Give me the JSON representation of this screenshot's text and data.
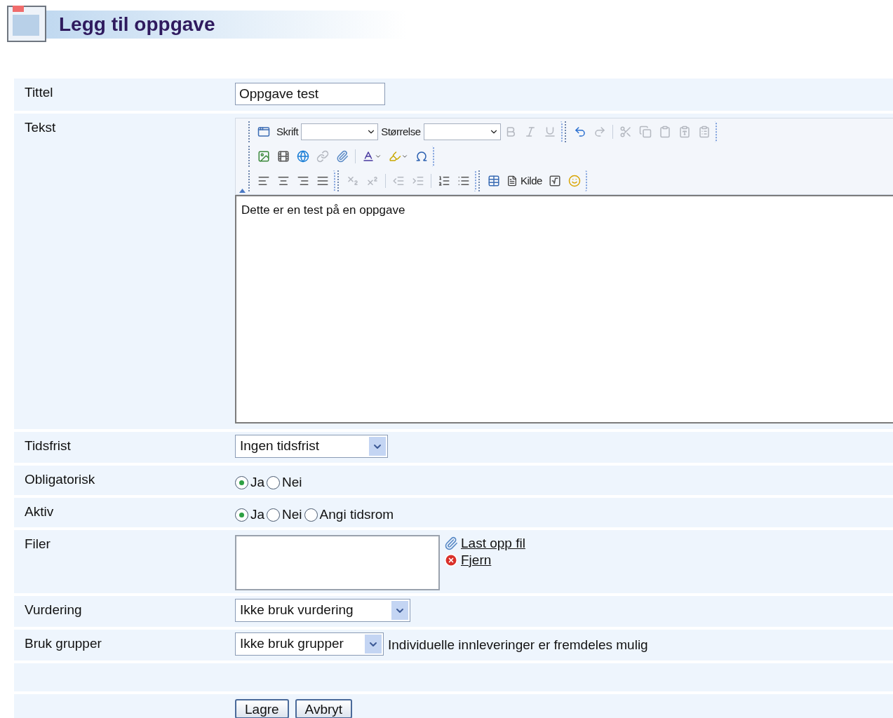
{
  "page_title": "Legg til oppgave",
  "form": [
    {
      "label": "Tittel",
      "kind": "text",
      "value": "Oppgave test"
    },
    {
      "label": "Tekst",
      "kind": "editor",
      "toolbar": [
        {
          "groups": [
            [
              {
                "kind": "maximize",
                "disabled": false
              },
              {
                "kind": "label",
                "text": "Skrift"
              },
              {
                "kind": "dropdown"
              },
              {
                "kind": "label",
                "text": "Størrelse"
              },
              {
                "kind": "dropdown"
              },
              {
                "kind": "bold",
                "disabled": true
              },
              {
                "kind": "italic",
                "disabled": true
              },
              {
                "kind": "underline",
                "disabled": true
              }
            ],
            [
              {
                "kind": "undo",
                "disabled": false
              },
              {
                "kind": "redo",
                "disabled": true
              },
              {
                "kind": "separator"
              },
              {
                "kind": "cut",
                "disabled": true
              },
              {
                "kind": "copy",
                "disabled": true
              },
              {
                "kind": "paste",
                "disabled": true
              },
              {
                "kind": "paste_text",
                "disabled": true
              },
              {
                "kind": "paste_word",
                "disabled": true
              }
            ]
          ]
        },
        {
          "groups": [
            [
              {
                "kind": "image",
                "disabled": false
              },
              {
                "kind": "flash",
                "disabled": false
              },
              {
                "kind": "globe",
                "disabled": false
              },
              {
                "kind": "link",
                "disabled": true
              },
              {
                "kind": "attach",
                "disabled": false
              },
              {
                "kind": "separator"
              },
              {
                "kind": "text_color",
                "disabled": false
              },
              {
                "kind": "highlight",
                "disabled": false
              },
              {
                "kind": "omega",
                "disabled": false
              }
            ]
          ]
        },
        {
          "groups": [
            [
              {
                "kind": "align_left",
                "disabled": false
              },
              {
                "kind": "align_center",
                "disabled": false
              },
              {
                "kind": "align_right",
                "disabled": false
              },
              {
                "kind": "align_justify",
                "disabled": false
              }
            ],
            [
              {
                "kind": "subscript",
                "disabled": true
              },
              {
                "kind": "superscript",
                "disabled": true
              },
              {
                "kind": "separator"
              },
              {
                "kind": "outdent",
                "disabled": true
              },
              {
                "kind": "indent",
                "disabled": true
              },
              {
                "kind": "separator"
              },
              {
                "kind": "ordered_list",
                "disabled": false
              },
              {
                "kind": "bullet_list",
                "disabled": false
              }
            ],
            [
              {
                "kind": "table",
                "disabled": false
              },
              {
                "kind": "source",
                "text": "Kilde"
              },
              {
                "kind": "math",
                "disabled": false
              },
              {
                "kind": "smiley",
                "disabled": false
              }
            ]
          ]
        }
      ],
      "content": "Dette er en test på en oppgave"
    },
    {
      "label": "Tidsfrist",
      "kind": "select",
      "value": "Ingen tidsfrist"
    },
    {
      "label": "Obligatorisk",
      "kind": "radio",
      "options": [
        {
          "label": "Ja",
          "selected": true
        },
        {
          "label": "Nei",
          "selected": false
        }
      ]
    },
    {
      "label": "Aktiv",
      "kind": "radio",
      "options": [
        {
          "label": "Ja",
          "selected": true
        },
        {
          "label": "Nei",
          "selected": false
        },
        {
          "label": "Angi tidsrom",
          "selected": false
        }
      ]
    },
    {
      "label": "Filer",
      "kind": "files",
      "links": [
        {
          "kind": "upload",
          "text": "Last opp fil"
        },
        {
          "kind": "remove",
          "text": "Fjern"
        }
      ]
    },
    {
      "label": "Vurdering",
      "kind": "select",
      "value": "Ikke bruk vurdering"
    },
    {
      "label": "Bruk grupper",
      "kind": "select",
      "value": "Ikke bruk grupper",
      "note": "Individuelle innleveringer er fremdeles mulig"
    },
    {
      "kind": "empty"
    }
  ],
  "buttons": [
    "Lagre",
    "Avbryt"
  ]
}
